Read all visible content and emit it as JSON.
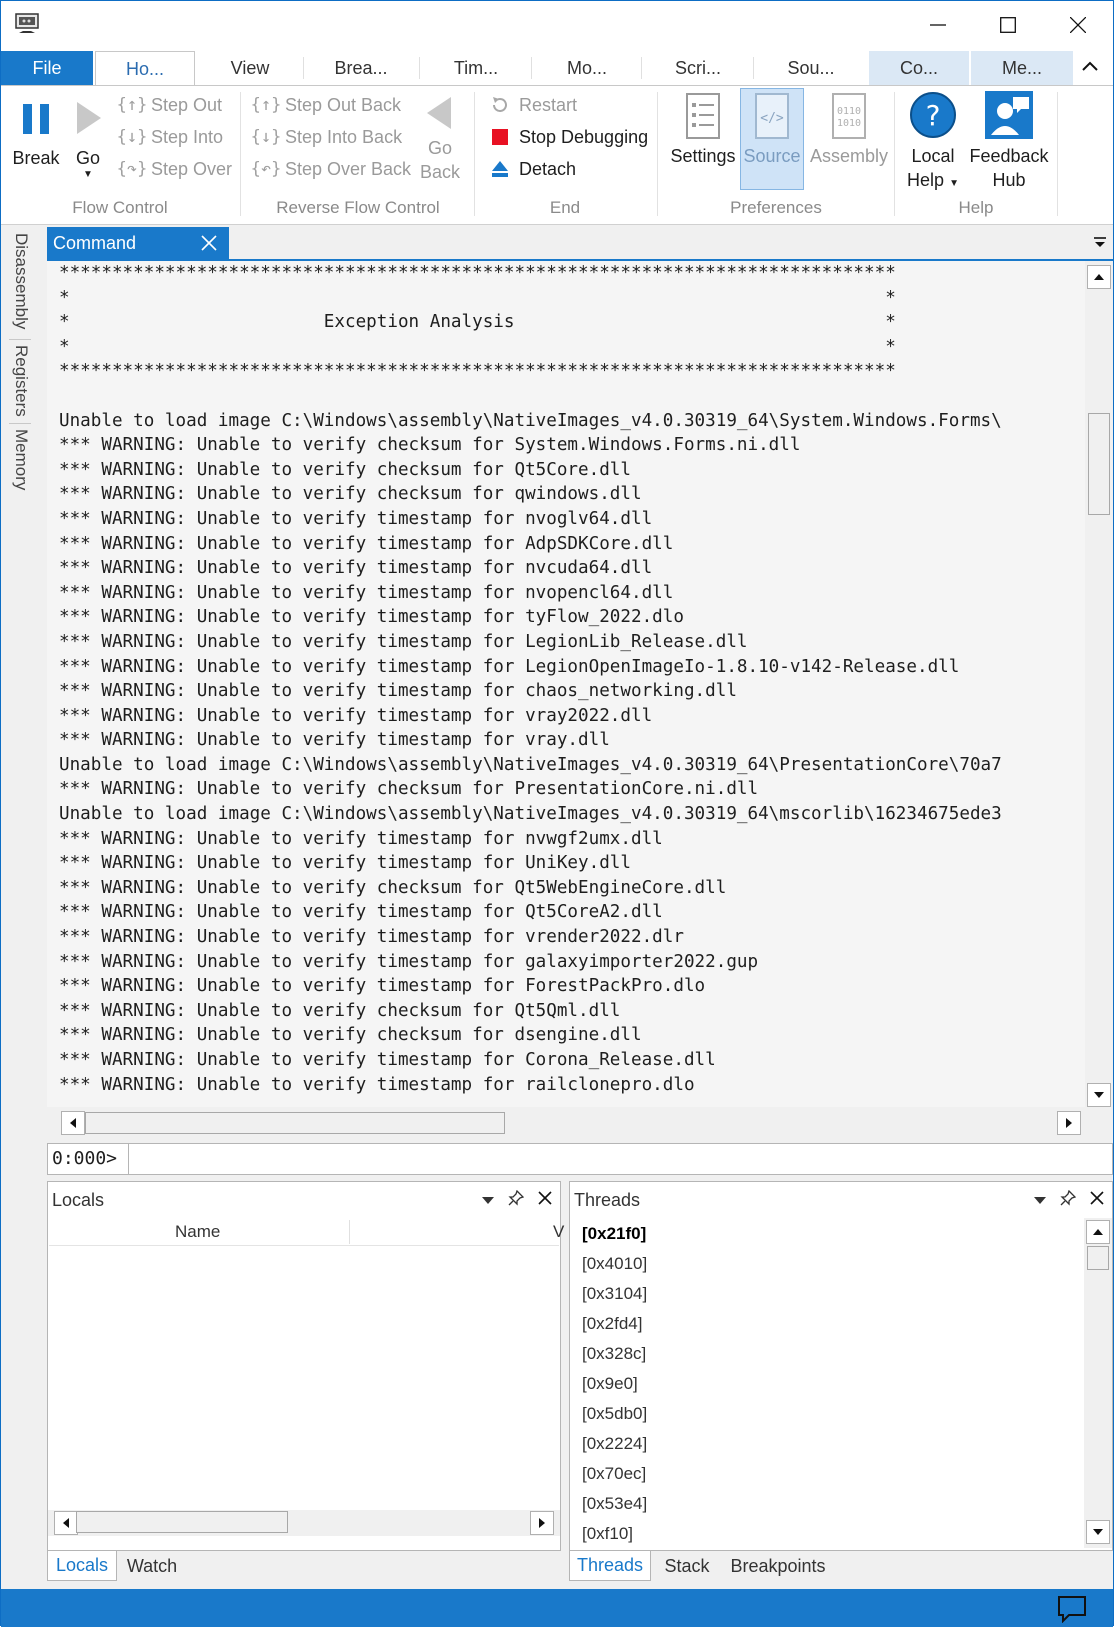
{
  "ribbon_tabs": {
    "file": "File",
    "home": "Ho...",
    "view": "View",
    "breakpoints": "Brea...",
    "time": "Tim...",
    "model": "Mo...",
    "scripting": "Scri...",
    "source": "Sou...",
    "command": "Co...",
    "memory": "Me..."
  },
  "flow_control": {
    "label": "Flow Control",
    "break": "Break",
    "go": "Go",
    "step_out": "Step Out",
    "step_into": "Step Into",
    "step_over": "Step Over"
  },
  "reverse_flow": {
    "label": "Reverse Flow Control",
    "step_out_back": "Step Out Back",
    "step_into_back": "Step Into Back",
    "step_over_back": "Step Over Back",
    "go_back_1": "Go",
    "go_back_2": "Back"
  },
  "end": {
    "label": "End",
    "restart": "Restart",
    "stop": "Stop Debugging",
    "detach": "Detach"
  },
  "preferences": {
    "label": "Preferences",
    "settings": "Settings",
    "source": "Source",
    "assembly": "Assembly"
  },
  "help": {
    "label": "Help",
    "local_help_1": "Local",
    "local_help_2": "Help",
    "feedback_1": "Feedback",
    "feedback_2": "Hub"
  },
  "side_tabs": {
    "disassembly": "Disassembly",
    "registers": "Registers",
    "memory": "Memory"
  },
  "command_panel": {
    "tab": "Command",
    "prompt": "0:000>",
    "input_value": "",
    "lines": [
      "*******************************************************************************",
      "*                                                                             *",
      "*                        Exception Analysis                                   *",
      "*                                                                             *",
      "*******************************************************************************",
      "",
      "Unable to load image C:\\Windows\\assembly\\NativeImages_v4.0.30319_64\\System.Windows.Forms\\",
      "*** WARNING: Unable to verify checksum for System.Windows.Forms.ni.dll",
      "*** WARNING: Unable to verify checksum for Qt5Core.dll",
      "*** WARNING: Unable to verify checksum for qwindows.dll",
      "*** WARNING: Unable to verify timestamp for nvoglv64.dll",
      "*** WARNING: Unable to verify timestamp for AdpSDKCore.dll",
      "*** WARNING: Unable to verify timestamp for nvcuda64.dll",
      "*** WARNING: Unable to verify timestamp for nvopencl64.dll",
      "*** WARNING: Unable to verify timestamp for tyFlow_2022.dlo",
      "*** WARNING: Unable to verify timestamp for LegionLib_Release.dll",
      "*** WARNING: Unable to verify timestamp for LegionOpenImageIo-1.8.10-v142-Release.dll",
      "*** WARNING: Unable to verify timestamp for chaos_networking.dll",
      "*** WARNING: Unable to verify timestamp for vray2022.dll",
      "*** WARNING: Unable to verify timestamp for vray.dll",
      "Unable to load image C:\\Windows\\assembly\\NativeImages_v4.0.30319_64\\PresentationCore\\70a7",
      "*** WARNING: Unable to verify checksum for PresentationCore.ni.dll",
      "Unable to load image C:\\Windows\\assembly\\NativeImages_v4.0.30319_64\\mscorlib\\16234675ede3",
      "*** WARNING: Unable to verify timestamp for nvwgf2umx.dll",
      "*** WARNING: Unable to verify timestamp for UniKey.dll",
      "*** WARNING: Unable to verify checksum for Qt5WebEngineCore.dll",
      "*** WARNING: Unable to verify timestamp for Qt5CoreA2.dll",
      "*** WARNING: Unable to verify timestamp for vrender2022.dlr",
      "*** WARNING: Unable to verify timestamp for galaxyimporter2022.gup",
      "*** WARNING: Unable to verify timestamp for ForestPackPro.dlo",
      "*** WARNING: Unable to verify checksum for Qt5Qml.dll",
      "*** WARNING: Unable to verify checksum for dsengine.dll",
      "*** WARNING: Unable to verify timestamp for Corona_Release.dll",
      "*** WARNING: Unable to verify timestamp for railclonepro.dlo"
    ]
  },
  "locals_panel": {
    "title": "Locals",
    "col_name": "Name",
    "col_value_partial": "V",
    "tab_locals": "Locals",
    "tab_watch": "Watch"
  },
  "threads_panel": {
    "title": "Threads",
    "items": [
      "[0x21f0]",
      "[0x4010]",
      "[0x3104]",
      "[0x2fd4]",
      "[0x328c]",
      "[0x9e0]",
      "[0x5db0]",
      "[0x2224]",
      "[0x70ec]",
      "[0x53e4]",
      "[0xf10]"
    ],
    "tab_threads": "Threads",
    "tab_stack": "Stack",
    "tab_breakpoints": "Breakpoints"
  },
  "colors": {
    "accent": "#1979ca",
    "stop_red": "#e81123",
    "selection": "#cfe3f7"
  },
  "icons": [
    "app-icon",
    "minimize-icon",
    "maximize-icon",
    "close-icon",
    "break-icon",
    "go-icon",
    "step-out-icon",
    "step-into-icon",
    "step-over-icon",
    "go-back-icon",
    "restart-icon",
    "stop-icon",
    "detach-icon",
    "settings-icon",
    "source-icon",
    "assembly-icon",
    "help-icon",
    "feedback-icon",
    "pin-icon",
    "chevron-down-icon",
    "chat-icon"
  ]
}
